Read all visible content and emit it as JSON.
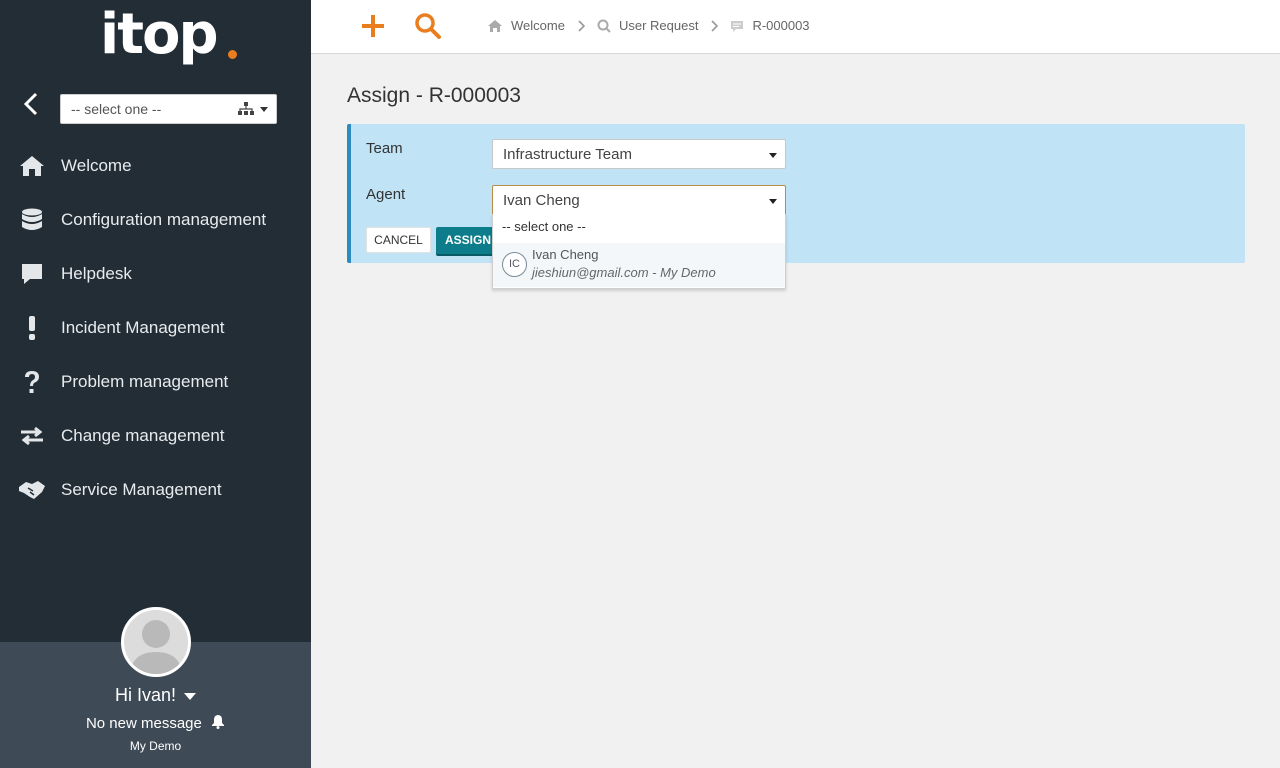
{
  "sidebar": {
    "logo": "itop",
    "org_select": "-- select one --",
    "menu": [
      {
        "label": "Welcome",
        "icon": "home-icon"
      },
      {
        "label": "Configuration management",
        "icon": "database-icon"
      },
      {
        "label": "Helpdesk",
        "icon": "comment-icon"
      },
      {
        "label": "Incident Management",
        "icon": "exclamation-icon"
      },
      {
        "label": "Problem management",
        "icon": "question-icon"
      },
      {
        "label": "Change management",
        "icon": "exchange-icon"
      },
      {
        "label": "Service Management",
        "icon": "handshake-icon"
      }
    ],
    "user": {
      "greeting": "Hi Ivan!",
      "messages": "No new message",
      "org": "My Demo"
    }
  },
  "topbar": {
    "breadcrumb": [
      "Welcome",
      "User Request",
      "R-000003"
    ]
  },
  "main": {
    "title": "Assign - R-000003",
    "team": {
      "label": "Team",
      "value": "Infrastructure Team"
    },
    "agent": {
      "label": "Agent",
      "value": "Ivan Cheng"
    },
    "cancel_label": "CANCEL",
    "assign_label": "ASSIGN",
    "dropdown": {
      "empty_option": "-- select one --",
      "option": {
        "initials": "IC",
        "name": "Ivan Cheng",
        "detail": "jieshiun@gmail.com - My Demo"
      }
    }
  },
  "colors": {
    "sidebar_bg": "#232d35",
    "accent_orange": "#ea7d1e",
    "panel_bg": "#c0e3f5",
    "assign_btn": "#0e7d8b"
  }
}
